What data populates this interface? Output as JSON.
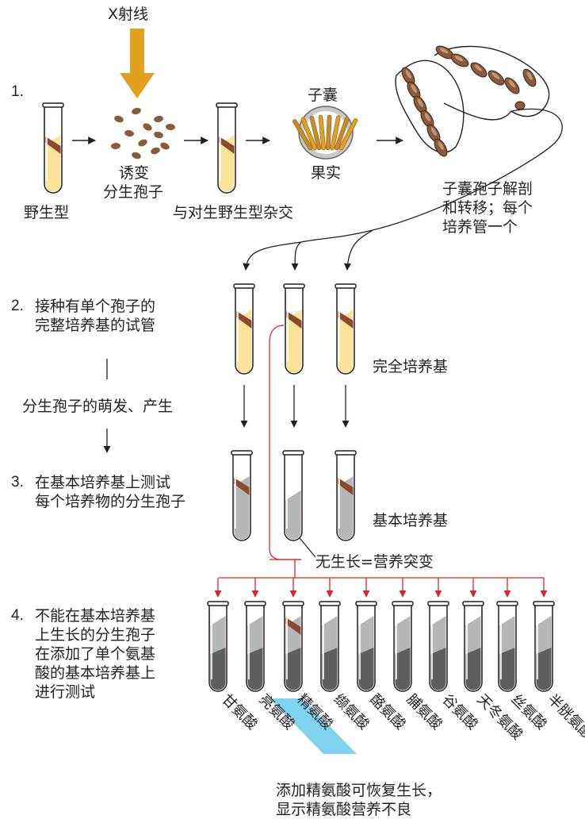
{
  "xray": "X射线",
  "step1": {
    "number": "1.",
    "wild_type": "野生型",
    "mutagenesis": "诱变",
    "conidia": "分生孢子",
    "cross": "与对生野生型杂交",
    "ascus": "子囊",
    "fruiting_body": "果实",
    "dissect_line1": "子囊孢子解剖",
    "dissect_line2": "和转移；每个",
    "dissect_line3": "培养管一个"
  },
  "step2": {
    "number": "2.",
    "line1": "接种有单个孢子的",
    "line2": "完整培养基的试管",
    "medium": "完全培养基"
  },
  "germination": "分生孢子的萌发、产生",
  "step3": {
    "number": "3.",
    "line1": "在基本培养基上测试",
    "line2": "每个培养物的分生孢子",
    "medium": "基本培养基",
    "no_growth": "无生长=营养突变"
  },
  "step4": {
    "number": "4.",
    "line1": "不能在基本培养基",
    "line2": "上生长的分生孢子",
    "line3": "在添加了单个氨基",
    "line4": "酸的基本培养基上",
    "line5": "进行测试"
  },
  "amino_acids": [
    "甘氨酸",
    "亮氨酸",
    "精氨酸",
    "缬氨酸",
    "酪氨酸",
    "脯氨酸",
    "谷氨酸",
    "天冬氨酸",
    "丝氨酸",
    "半胱氨酸"
  ],
  "highlight_index": 2,
  "conclusion_line1": "添加精氨酸可恢复生长，",
  "conclusion_line2": "显示精氨酸营养不良",
  "colors": {
    "xray_arrow": "#e2a020",
    "complete_medium": "#fbe39a",
    "minimal_medium": "#b5b6b8",
    "minimal_dark": "#5d5e60",
    "mold": "#8a4b2c",
    "spore": "#8a5a3a",
    "red_line": "#d7262b",
    "highlight": "#7fd3f0"
  }
}
